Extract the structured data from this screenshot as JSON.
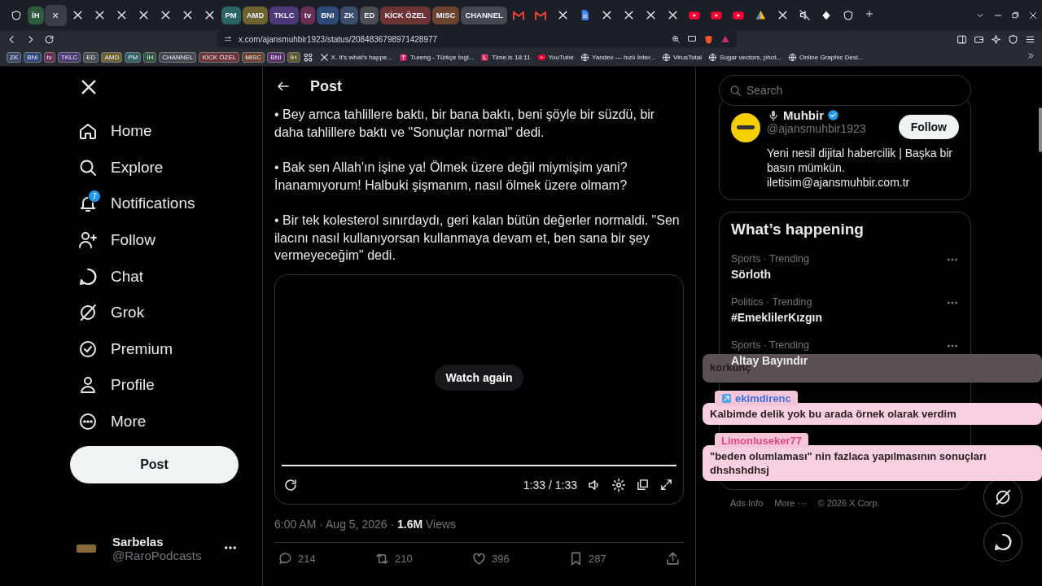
{
  "browser": {
    "tabs": [
      {
        "kind": "shield",
        "selected": false
      },
      {
        "kind": "group",
        "label": "İH",
        "color": "#2e5a3f",
        "selected": false
      },
      {
        "kind": "active",
        "label": "×",
        "selected": true
      },
      {
        "kind": "x",
        "selected": false
      },
      {
        "kind": "x",
        "selected": false
      },
      {
        "kind": "x",
        "selected": false
      },
      {
        "kind": "x",
        "selected": false
      },
      {
        "kind": "x",
        "selected": false
      },
      {
        "kind": "x",
        "selected": false
      },
      {
        "kind": "x",
        "selected": false
      },
      {
        "kind": "group",
        "label": "PM",
        "color": "#2c6566",
        "selected": false
      },
      {
        "kind": "group",
        "label": "AMD",
        "color": "#6e6330",
        "selected": false
      },
      {
        "kind": "group",
        "label": "TKLC",
        "color": "#4f3a78",
        "selected": false
      },
      {
        "kind": "group",
        "label": "tv",
        "color": "#6a2f55",
        "selected": false
      },
      {
        "kind": "group",
        "label": "BNI",
        "color": "#2f4a78",
        "selected": false
      },
      {
        "kind": "group",
        "label": "ZK",
        "color": "#3b4d6a",
        "selected": false
      },
      {
        "kind": "group",
        "label": "ED",
        "color": "#4a4d52",
        "selected": false
      },
      {
        "kind": "group",
        "label": "KİCK ÖZEL",
        "color": "#6e3334",
        "selected": false
      },
      {
        "kind": "group",
        "label": "MISC",
        "color": "#6b4330",
        "selected": false
      },
      {
        "kind": "group",
        "label": "CHANNEL",
        "color": "#454a52",
        "selected": false
      },
      {
        "kind": "mail",
        "selected": false
      },
      {
        "kind": "mail",
        "selected": false
      },
      {
        "kind": "x",
        "selected": false
      },
      {
        "kind": "doc",
        "selected": false
      },
      {
        "kind": "x",
        "selected": false
      },
      {
        "kind": "x",
        "selected": false
      },
      {
        "kind": "x",
        "selected": false
      },
      {
        "kind": "x",
        "selected": false
      },
      {
        "kind": "video",
        "selected": false
      },
      {
        "kind": "video",
        "selected": false
      },
      {
        "kind": "video",
        "selected": false
      },
      {
        "kind": "triangle",
        "selected": false
      },
      {
        "kind": "x",
        "selected": false
      },
      {
        "kind": "mute",
        "selected": false
      },
      {
        "kind": "diamond",
        "selected": false
      },
      {
        "kind": "shield",
        "selected": false
      }
    ],
    "address": "x.com/ajansmuhbir1923/status/2084836798971428977",
    "bookmark_groups": [
      {
        "label": "ZK",
        "color": "#3b4d6a"
      },
      {
        "label": "BNI",
        "color": "#2f4a78"
      },
      {
        "label": "tv",
        "color": "#6a2f55"
      },
      {
        "label": "TKLC",
        "color": "#4f3a78"
      },
      {
        "label": "ED",
        "color": "#4a4d52"
      },
      {
        "label": "AMD",
        "color": "#6e6330"
      },
      {
        "label": "PM",
        "color": "#2c6566"
      },
      {
        "label": "İH",
        "color": "#2e5a3f"
      },
      {
        "label": "CHANNEL",
        "color": "#454a52"
      },
      {
        "label": "KİCK ÖZEL",
        "color": "#6e3334"
      },
      {
        "label": "MISC",
        "color": "#6b4330"
      },
      {
        "label": "BNİ",
        "color": "#5a2f6a"
      },
      {
        "label": "İH",
        "color": "#5e5a2e"
      }
    ],
    "bookmarks": [
      {
        "kind": "x",
        "label": "X. It's what's happe..."
      },
      {
        "kind": "t",
        "label": "Tureng - Türkçe İngi..."
      },
      {
        "kind": "clock",
        "label": "Time.is 18:11"
      },
      {
        "kind": "video",
        "label": "YouTube"
      },
      {
        "kind": "globe",
        "label": "Yandex — hızlı İnter..."
      },
      {
        "kind": "globe",
        "label": "VirusTotal"
      },
      {
        "kind": "globe",
        "label": "Sugar vectors, phot..."
      },
      {
        "kind": "globe",
        "label": "Online Graphic Desi..."
      }
    ]
  },
  "nav": {
    "items": [
      {
        "kind": "home",
        "label": "Home"
      },
      {
        "kind": "search",
        "label": "Explore"
      },
      {
        "kind": "bell",
        "label": "Notifications",
        "badge": "7"
      },
      {
        "kind": "follow",
        "label": "Follow"
      },
      {
        "kind": "chat",
        "label": "Chat"
      },
      {
        "kind": "grok",
        "label": "Grok"
      },
      {
        "kind": "premium",
        "label": "Premium"
      },
      {
        "kind": "profile",
        "label": "Profile"
      },
      {
        "kind": "more",
        "label": "More"
      }
    ],
    "post_button": "Post",
    "account": {
      "name": "Sarbelas",
      "handle": "@RaroPodcasts"
    }
  },
  "post": {
    "header": "Post",
    "paragraphs": [
      "• Bey amca tahlillere baktı, bir bana baktı, beni şöyle bir süzdü, bir daha tahlillere baktı ve \"Sonuçlar normal\" dedi.",
      "• Bak sen Allah'ın işine ya! Ölmek üzere değil miymişim yani? İnanamıyorum! Halbuki şişmanım, nasıl ölmek üzere olmam?",
      "• Bir tek kolesterol sınırdaydı, geri kalan bütün değerler normaldi. \"Sen ilacını nasıl kullanıyorsan kullanmaya devam et, ben sana bir şey vermeyeceğim\" dedi."
    ],
    "video": {
      "button": "Watch again",
      "time": "1:33 / 1:33",
      "level": 1
    },
    "meta": "6:00 AM · Aug 5, 2026 · **1.6M** Views",
    "actions": [
      {
        "kind": "reply",
        "count": "214"
      },
      {
        "kind": "repost",
        "count": "210"
      },
      {
        "kind": "like",
        "count": "396"
      },
      {
        "kind": "bookmark",
        "count": "287"
      },
      {
        "kind": "share"
      }
    ]
  },
  "sidebar": {
    "search": {
      "placeholder": "Search"
    },
    "profile": {
      "name": "Muhbir",
      "handle": "@ajansmuhbir1923",
      "follow": "Follow",
      "bio": "Yeni nesil dijital habercilik | Başka bir basın mümkün. iletisim@ajansmuhbir.com.tr"
    },
    "trends_title": "What’s happening",
    "trends": [
      {
        "meta": "Sports · Trending",
        "title": "Sörloth"
      },
      {
        "meta": "Politics · Trending",
        "title": "#EmeklilerKızgın"
      },
      {
        "meta": "Sports · Trending",
        "title": "Altay Bayındır"
      }
    ],
    "footer": [
      "Ads Info",
      "More ···",
      "© 2026 X Corp."
    ]
  },
  "chat_overlay": [
    {
      "message": "korkunç",
      "color": "#5b5154"
    },
    {
      "user": {
        "name": "ekimdirenc",
        "color": "#3f6fd6",
        "badge": true
      },
      "message": "Kalbimde delik yok bu arada örnek olarak verdim",
      "color": "#f7cfe0"
    },
    {
      "user": {
        "name": "Limonluseker77",
        "color": "#e0487c"
      },
      "message": "\"beden olumlaması\" nin fazlaca yapılmasının sonuçları dhshshdhsj",
      "color": "#f7cfe0"
    }
  ]
}
